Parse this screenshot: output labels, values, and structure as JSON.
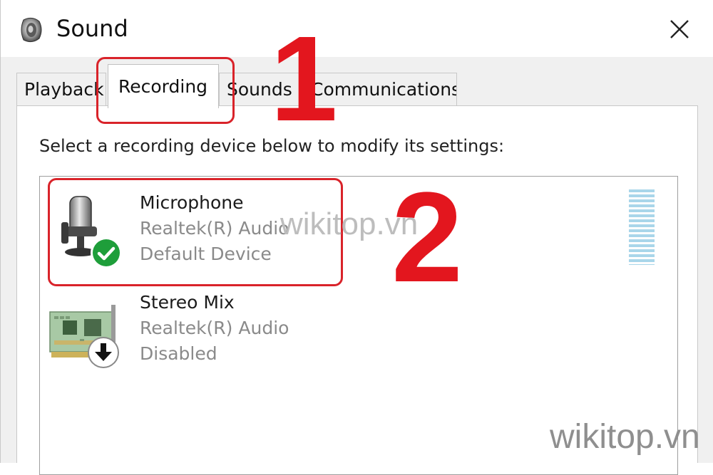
{
  "window": {
    "title": "Sound",
    "title_icon": "speaker-icon",
    "close_icon": "close-icon"
  },
  "tabs": [
    {
      "label": "Playback",
      "active": false
    },
    {
      "label": "Recording",
      "active": true
    },
    {
      "label": "Sounds",
      "active": false
    },
    {
      "label": "Communications",
      "active": false
    }
  ],
  "panel": {
    "instruction": "Select a recording device below to modify its settings:"
  },
  "devices": [
    {
      "name": "Microphone",
      "driver": "Realtek(R) Audio",
      "status": "Default Device",
      "icon": "microphone-icon",
      "status_icon": "checkmark-icon",
      "selected": true
    },
    {
      "name": "Stereo Mix",
      "driver": "Realtek(R) Audio",
      "status": "Disabled",
      "icon": "sound-card-icon",
      "status_icon": "down-arrow-icon",
      "selected": false
    }
  ],
  "annotations": {
    "step1": "1",
    "step2": "2",
    "color": "#e3161e"
  },
  "watermarks": [
    "wikitop.vn",
    "wikitop.vn"
  ],
  "colors": {
    "meter": "#a9d6ea",
    "check_green": "#1e9e3a",
    "dialog_bg": "#f0f0f0"
  }
}
